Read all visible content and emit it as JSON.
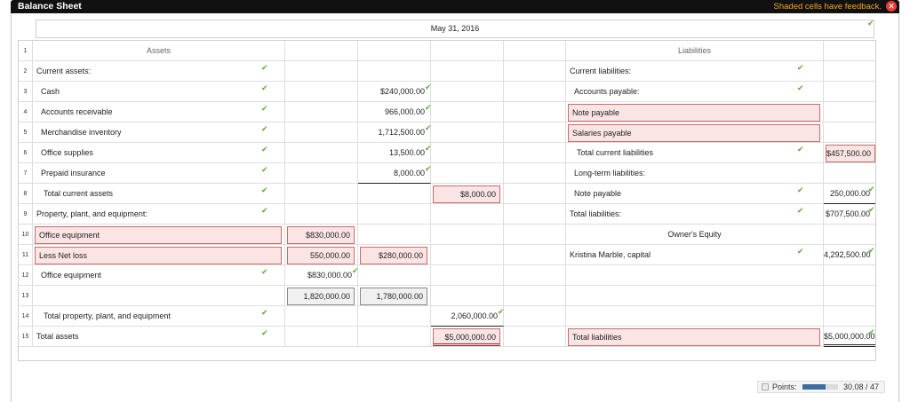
{
  "window": {
    "title": "Balance Sheet",
    "feedback": "Shaded cells have feedback.",
    "close_glyph": "✕"
  },
  "date": "May 31, 2016",
  "headers": {
    "assets": "Assets",
    "liabilities": "Liabilities"
  },
  "check_glyph": "✔",
  "rows": {
    "r1": {
      "n": "1"
    },
    "r2": {
      "n": "2",
      "a": "Current assets:",
      "l": "Current liabilities:"
    },
    "r3": {
      "n": "3",
      "a": "Cash",
      "c2": "$240,000.00",
      "l": "Accounts payable:"
    },
    "r4": {
      "n": "4",
      "a": "Accounts receivable",
      "c2": "966,000.00",
      "l": "Note payable"
    },
    "r5": {
      "n": "5",
      "a": "Merchandise inventory",
      "c2": "1,712,500.00",
      "l": "Salaries payable"
    },
    "r6": {
      "n": "6",
      "a": "Office supplies",
      "c2": "13,500.00",
      "l": "Total current liabilities",
      "lv": "$457,500.00"
    },
    "r7": {
      "n": "7",
      "a": "Prepaid insurance",
      "c2": "8,000.00",
      "l": "Long-term liabilities:"
    },
    "r8": {
      "n": "8",
      "a": "Total current assets",
      "c3": "$8,000.00",
      "l": "Note payable",
      "lv": "250,000.00"
    },
    "r9": {
      "n": "9",
      "a": "Property, plant, and equipment:",
      "l": "Total liabilities:",
      "lv": "$707,500.00"
    },
    "r10": {
      "n": "10",
      "a": "Office equipment",
      "c1": "$830,000.00",
      "l": "Owner's Equity"
    },
    "r11": {
      "n": "11",
      "a": "Less Net loss",
      "c1": "550,000.00",
      "c2": "$280,000.00",
      "l": "Kristina Marble, capital",
      "lv": "4,292,500.00"
    },
    "r12": {
      "n": "12",
      "a": "Office equipment",
      "c1": "$830,000.00"
    },
    "r13": {
      "n": "13",
      "c1": "1,820,000.00",
      "c2": "1,780,000.00"
    },
    "r14": {
      "n": "14",
      "a": "Total property, plant, and equipment",
      "c3": "2,060,000.00"
    },
    "r15": {
      "n": "15",
      "a": "Total assets",
      "c3": "$5,000,000.00",
      "l": "Total liabilities",
      "lv": "$5,000,000.00"
    }
  },
  "points": {
    "label": "Points:",
    "value": "30.08 / 47",
    "fraction": 0.64
  }
}
